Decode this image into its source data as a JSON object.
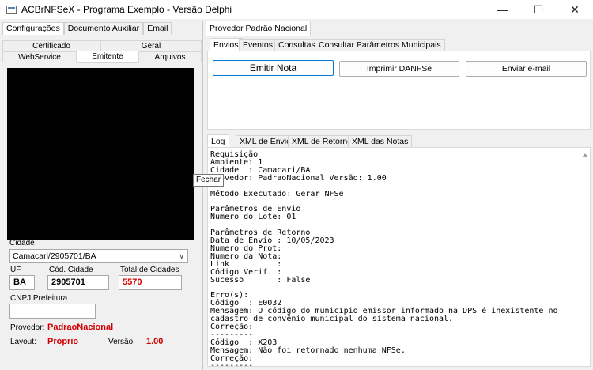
{
  "window": {
    "title": "ACBrNFSeX - Programa Exemplo - Versão Delphi",
    "minimize": "—",
    "maximize": "☐",
    "close": "✕"
  },
  "left": {
    "tabs": [
      "Configurações",
      "Documento Auxiliar",
      "Email"
    ],
    "grid_tabs_row1": [
      "Certificado",
      "Geral"
    ],
    "grid_tabs_row2": [
      "WebService",
      "Emitente",
      "Arquivos"
    ],
    "cidade_label": "Cidade",
    "cidade_value": "Camacari/2905701/BA",
    "uf_label": "UF",
    "uf_value": "BA",
    "cod_cidade_label": "Cód. Cidade",
    "cod_cidade_value": "2905701",
    "total_label": "Total de Cidades",
    "total_value": "5570",
    "cnpj_label": "CNPJ Prefeitura",
    "cnpj_value": "",
    "provedor_label": "Provedor:",
    "provedor_value": "PadraoNacional",
    "layout_label": "Layout:",
    "layout_value": "Próprio",
    "versao_label": "Versão:",
    "versao_value": "1.00"
  },
  "right": {
    "panel_tab": "Provedor Padrão Nacional",
    "tabs": [
      "Envios",
      "Eventos",
      "Consultas",
      "Consultar Parâmetros Municipais"
    ],
    "buttons": {
      "emitir": "Emitir Nota",
      "imprimir": "Imprimir DANFSe",
      "email": "Enviar e-mail"
    },
    "log_tabs": [
      "Log",
      "XML de Envio",
      "XML de Retorno",
      "XML das Notas"
    ],
    "log_lines": [
      "Requisição",
      "Ambiente: 1",
      "Cidade  : Camacari/BA",
      "Provedor: PadraoNacional Versão: 1.00",
      "",
      "Método Executado: Gerar NFSe",
      "",
      "Parâmetros de Envio",
      "Numero do Lote: 01",
      "",
      "Parâmetros de Retorno",
      "Data de Envio : 10/05/2023",
      "Numero do Prot:",
      "Numero da Nota:",
      "Link          :",
      "Código Verif. :",
      "Sucesso       : False",
      "",
      "Erro(s):",
      "Código  : E0032",
      "Mensagem: O código do município emissor informado na DPS é inexistente no",
      "cadastro de convênio municipal do sistema nacional.",
      "Correção:",
      "---------",
      "Código  : X203",
      "Mensagem: Não foi retornado nenhuma NFSe.",
      "Correção:",
      "---------"
    ]
  },
  "tooltip": "Fechar"
}
